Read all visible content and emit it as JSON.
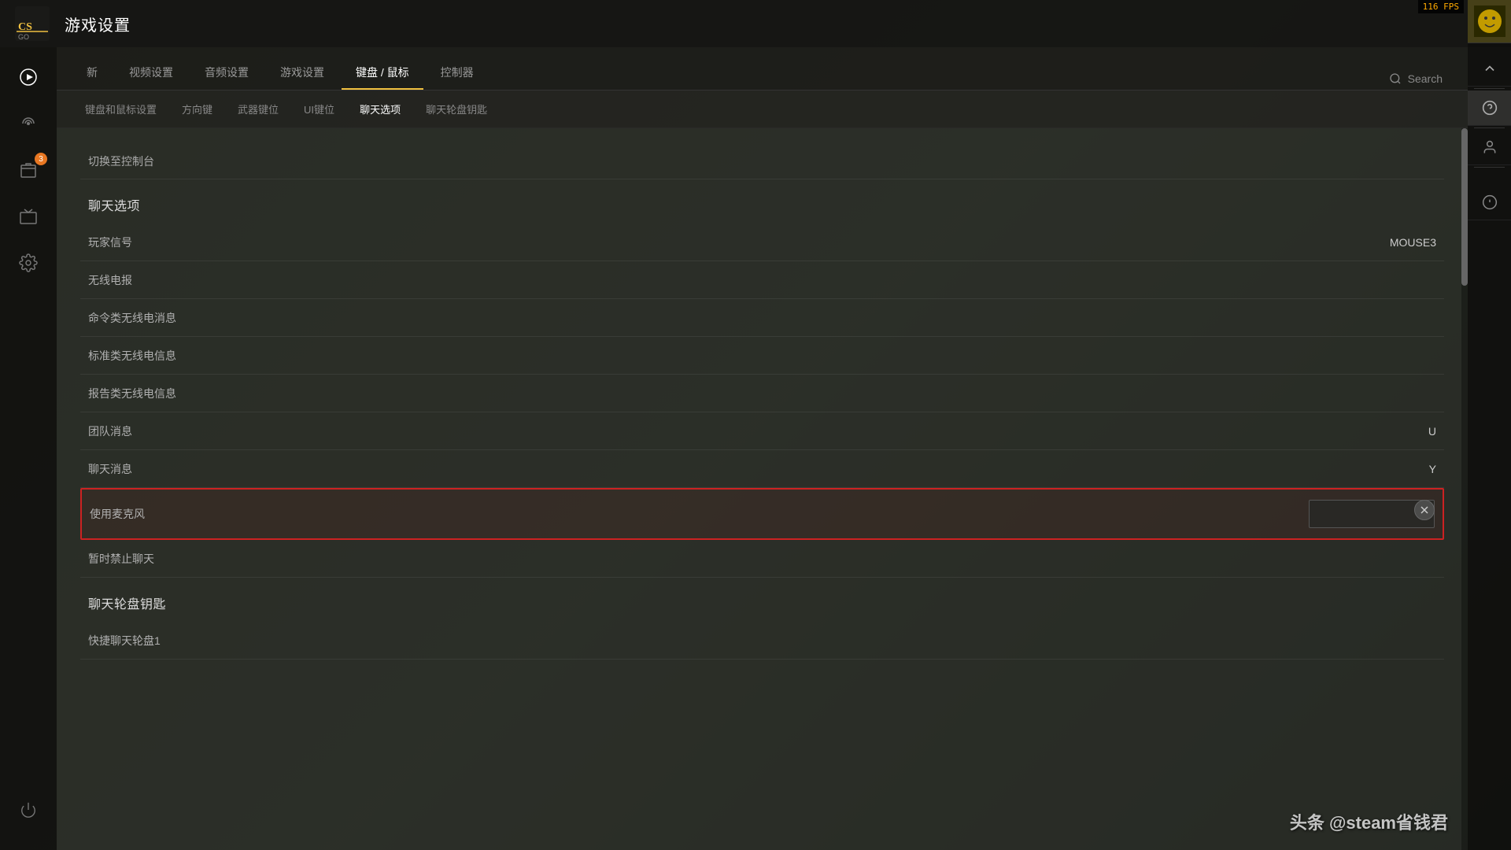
{
  "app": {
    "title": "游戏设置",
    "fps": "116 FPS"
  },
  "nav_tabs": [
    {
      "id": "new",
      "label": "新",
      "active": false
    },
    {
      "id": "video",
      "label": "视频设置",
      "active": false
    },
    {
      "id": "audio",
      "label": "音频设置",
      "active": false
    },
    {
      "id": "game",
      "label": "游戏设置",
      "active": false
    },
    {
      "id": "keyboard_mouse",
      "label": "键盘 / 鼠标",
      "active": true
    },
    {
      "id": "controller",
      "label": "控制器",
      "active": false
    }
  ],
  "search": {
    "label": "Search"
  },
  "sub_tabs": [
    {
      "id": "keyboard_mouse_settings",
      "label": "键盘和鼠标设置",
      "active": false
    },
    {
      "id": "direction_keys",
      "label": "方向键",
      "active": false
    },
    {
      "id": "weapon_keys",
      "label": "武器键位",
      "active": false
    },
    {
      "id": "ui_keys",
      "label": "UI键位",
      "active": false
    },
    {
      "id": "chat_options",
      "label": "聊天选项",
      "active": true
    },
    {
      "id": "chat_wheel_keys",
      "label": "聊天轮盘钥匙",
      "active": false
    }
  ],
  "truncated_row": {
    "label": "切换至控制台",
    "value": ""
  },
  "sections": [
    {
      "id": "chat_options",
      "title": "聊天选项",
      "rows": [
        {
          "id": "player_signal",
          "label": "玩家信号",
          "value": "MOUSE3",
          "highlighted": false
        },
        {
          "id": "radio",
          "label": "无线电报",
          "value": "",
          "highlighted": false
        },
        {
          "id": "command_radio",
          "label": "命令类无线电消息",
          "value": "",
          "highlighted": false
        },
        {
          "id": "standard_radio",
          "label": "标准类无线电信息",
          "value": "",
          "highlighted": false
        },
        {
          "id": "report_radio",
          "label": "报告类无线电信息",
          "value": "",
          "highlighted": false
        },
        {
          "id": "team_message",
          "label": "团队消息",
          "value": "U",
          "highlighted": false
        },
        {
          "id": "chat_message",
          "label": "聊天消息",
          "value": "Y",
          "highlighted": false
        },
        {
          "id": "use_mic",
          "label": "使用麦克风",
          "value": "",
          "highlighted": true
        },
        {
          "id": "mute_chat",
          "label": "暂时禁止聊天",
          "value": "",
          "highlighted": false
        }
      ]
    },
    {
      "id": "chat_wheel_keys",
      "title": "聊天轮盘钥匙",
      "rows": [
        {
          "id": "quick_chat_wheel1",
          "label": "快捷聊天轮盘1",
          "value": "",
          "highlighted": false
        }
      ]
    }
  ],
  "left_sidebar": {
    "items": [
      {
        "id": "play",
        "icon": "play",
        "active": true
      },
      {
        "id": "broadcast",
        "icon": "broadcast",
        "active": false
      },
      {
        "id": "inventory",
        "icon": "inventory",
        "badge": "3",
        "active": false
      },
      {
        "id": "tv",
        "icon": "tv",
        "active": false
      },
      {
        "id": "settings",
        "icon": "settings",
        "active": false
      }
    ]
  },
  "right_sidebar": {
    "icons": [
      "chevron-up",
      "question",
      "divider",
      "user",
      "divider",
      "info"
    ]
  },
  "watermark": "头条 @steam省钱君"
}
